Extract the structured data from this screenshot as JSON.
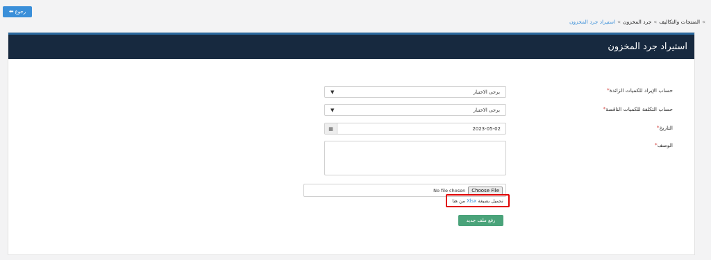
{
  "back_button": {
    "label": "رجوع",
    "icon": "arrow-left-icon"
  },
  "breadcrumb": {
    "items": [
      "المنتجات والتكاليف",
      "جرد المخزون",
      "استيراد جرد المخزون"
    ],
    "separator": "»"
  },
  "panel": {
    "title": "استيراد جرد المخزون"
  },
  "form": {
    "surplus_account": {
      "label": "حساب الإيراد للكميات الزائدة",
      "required_mark": "*",
      "selected": "يرجى الاختيار"
    },
    "shortage_account": {
      "label": "حساب التكلفة للكميات الناقصة",
      "required_mark": "*",
      "selected": "يرجى الاختيار"
    },
    "date": {
      "label": "التاريخ",
      "required_mark": "*",
      "value": "2023-05-02"
    },
    "description": {
      "label": "الوصف",
      "required_mark": "*",
      "value": ""
    },
    "file": {
      "choose_label": "Choose File",
      "status": "No file chosen"
    },
    "download_hint": {
      "prefix": "تحميل بصيغة",
      "format": "Xlsx",
      "suffix": "من هنا"
    },
    "submit_label": "رفع ملف جديد"
  },
  "colors": {
    "accent": "#3a8fd9",
    "header_bg": "#17293f",
    "submit_bg": "#4aa37a",
    "highlight_border": "#e00000"
  }
}
